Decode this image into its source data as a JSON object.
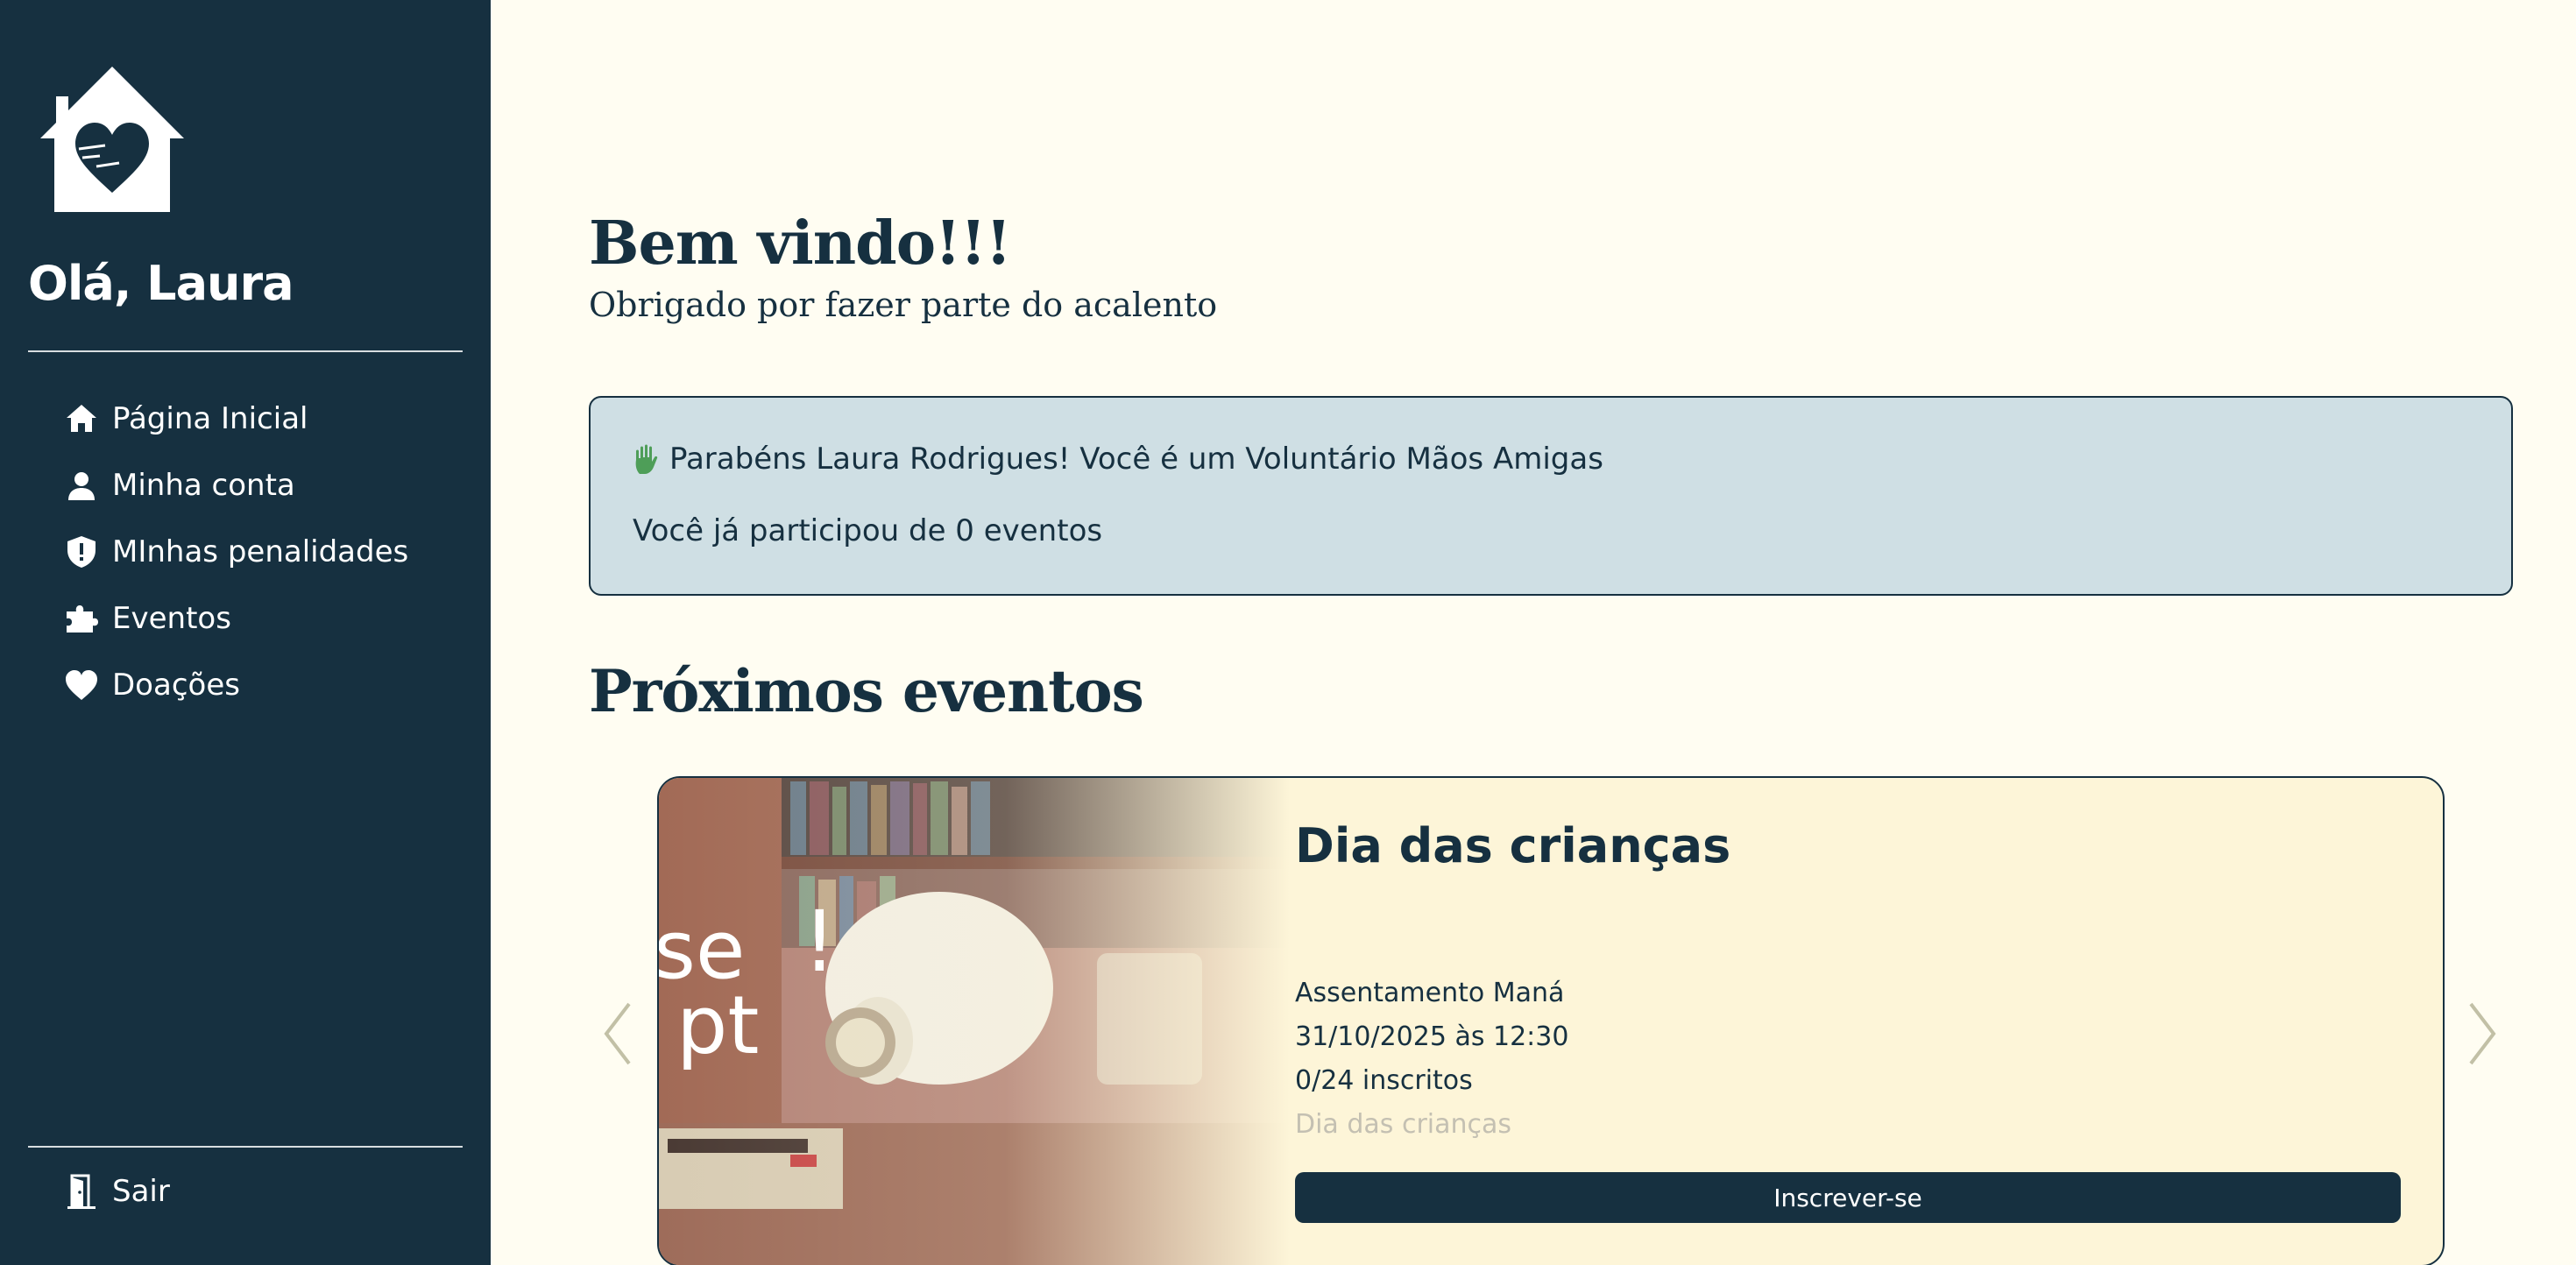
{
  "sidebar": {
    "greeting": "Olá, Laura",
    "logo_icon": "house-heart-icon",
    "nav": [
      {
        "label": "Página Inicial",
        "icon": "home-icon"
      },
      {
        "label": "Minha conta",
        "icon": "user-icon"
      },
      {
        "label": "MInhas penalidades",
        "icon": "shield-alert-icon"
      },
      {
        "label": "Eventos",
        "icon": "puzzle-icon"
      },
      {
        "label": "Doações",
        "icon": "heart-icon"
      }
    ],
    "logout": {
      "label": "Sair",
      "icon": "door-icon"
    }
  },
  "main": {
    "title": "Bem vindo!!!",
    "subtitle": "Obrigado por fazer parte do acalento",
    "info": {
      "message": "Parabéns Laura Rodrigues! Você é um Voluntário Mãos Amigas",
      "icon": "raised-hand-icon",
      "participation": "Você já participou de 0 eventos"
    },
    "upcoming_title": "Próximos eventos",
    "event": {
      "title": "Dia das crianças",
      "location": "Assentamento Maná",
      "datetime": "31/10/2025 às 12:30",
      "enrolled": "0/24 inscritos",
      "description": "Dia das crianças",
      "button_label": "Inscrever-se"
    }
  },
  "colors": {
    "sidebar_bg": "#163040",
    "page_bg": "#fffdf2",
    "info_bg": "#cfdfe4",
    "card_bg": "#fdf5d8",
    "accent": "#163040"
  }
}
